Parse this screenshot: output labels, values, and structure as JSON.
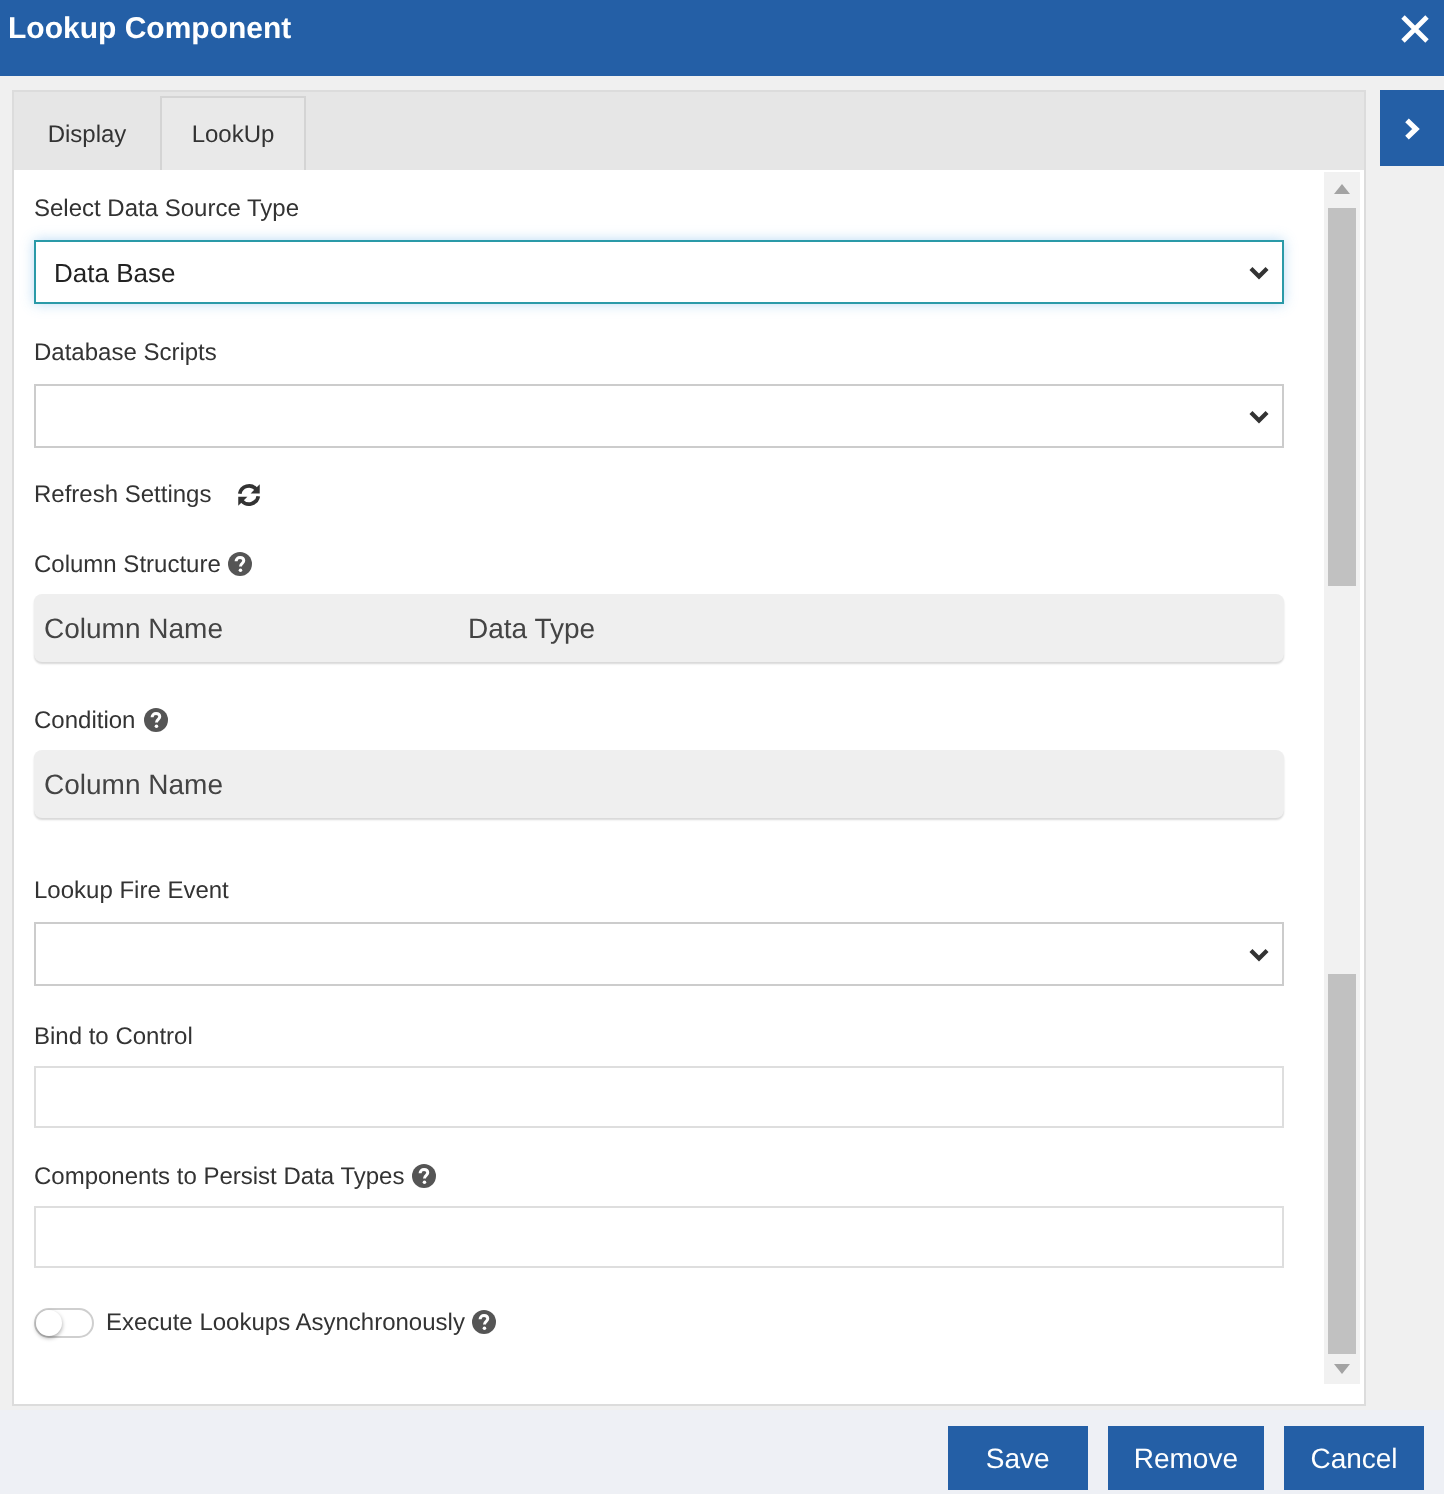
{
  "window": {
    "title": "Lookup Component"
  },
  "tabs": [
    {
      "label": "Display",
      "selected": false
    },
    {
      "label": "LookUp",
      "selected": true
    }
  ],
  "fields": [
    {
      "kind": "select",
      "label": "Select Data Source Type",
      "value": "Data Base",
      "focused": true
    },
    {
      "kind": "select",
      "label": "Database Scripts",
      "focused": false
    },
    {
      "kind": "action",
      "label": "Refresh Settings"
    },
    {
      "kind": "grid",
      "label": "Column Structure",
      "help": true,
      "columns": [
        "Column Name",
        "Data Type"
      ]
    },
    {
      "kind": "grid",
      "label": "Condition",
      "help": true,
      "columns": [
        "Column Name"
      ]
    },
    {
      "kind": "select",
      "label": "Lookup Fire Event",
      "focused": false
    },
    {
      "kind": "input",
      "label": "Bind to Control"
    },
    {
      "kind": "input",
      "label": "Components to Persist Data Types",
      "help": true
    },
    {
      "kind": "toggle",
      "label": "Execute Lookups Asynchronously",
      "on": false,
      "help": true
    }
  ],
  "buttons": [
    {
      "label": "Save"
    },
    {
      "label": "Remove"
    },
    {
      "label": "Cancel"
    }
  ]
}
